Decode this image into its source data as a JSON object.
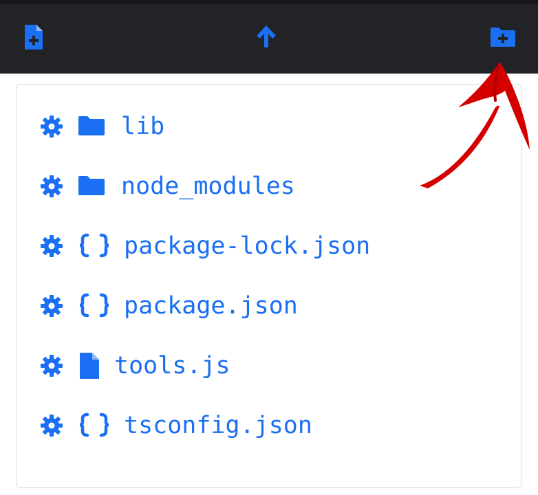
{
  "toolbar": {
    "new_file_icon": "file-plus-icon",
    "up_icon": "arrow-up-icon",
    "new_folder_icon": "folder-plus-icon",
    "icon_color": "#1a6ff2",
    "background": "#222326"
  },
  "files": [
    {
      "name": "lib",
      "type": "folder",
      "type_icon": "folder-icon"
    },
    {
      "name": "node_modules",
      "type": "folder",
      "type_icon": "folder-icon"
    },
    {
      "name": "package-lock.json",
      "type": "json",
      "type_icon": "braces-icon"
    },
    {
      "name": "package.json",
      "type": "json",
      "type_icon": "braces-icon"
    },
    {
      "name": "tools.js",
      "type": "file",
      "type_icon": "file-icon"
    },
    {
      "name": "tsconfig.json",
      "type": "json",
      "type_icon": "braces-icon"
    }
  ],
  "annotation": {
    "arrow_color": "#d40000",
    "arrow_icon": "red-arrow-annotation"
  }
}
